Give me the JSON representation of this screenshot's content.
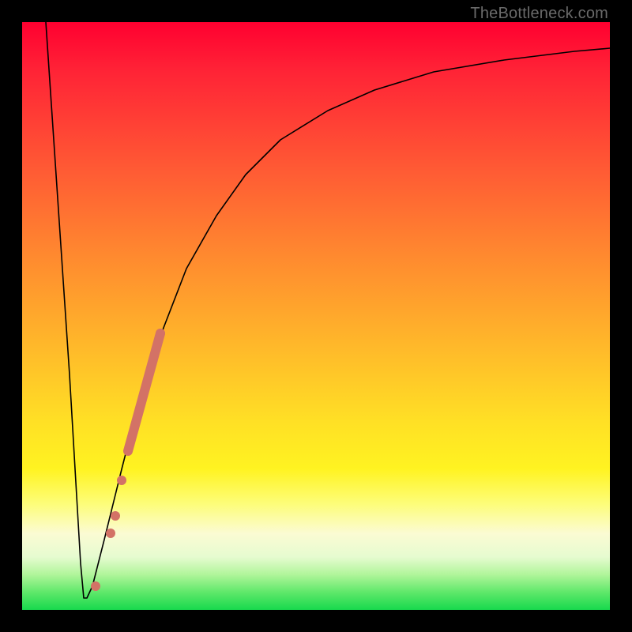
{
  "credit": "TheBottleneck.com",
  "colors": {
    "frame": "#000000",
    "curve": "#000000",
    "marker": "#d37266",
    "gradient_stops": [
      "#ff0030",
      "#ff2236",
      "#ff5a34",
      "#ff8a2f",
      "#ffb82a",
      "#ffe025",
      "#fff321",
      "#fdfd7a",
      "#fbfbd3",
      "#e6fbd0",
      "#b0f59a",
      "#5fe86a",
      "#17d94d"
    ]
  },
  "chart_data": {
    "type": "line",
    "title": "",
    "xlabel": "",
    "ylabel": "",
    "xlim": [
      0,
      100
    ],
    "ylim": [
      0,
      100
    ],
    "note": "No axis tick labels are rendered in the image; values below are read as % of plot width (x) and plot height (y) from bottom-left of the gradient area.",
    "series": [
      {
        "name": "curve",
        "x": [
          4,
          6,
          8,
          10,
          10.5,
          11,
          12,
          14,
          17,
          20,
          24,
          28,
          33,
          38,
          44,
          52,
          60,
          70,
          82,
          94,
          100
        ],
        "y": [
          100,
          70,
          40,
          8,
          2,
          2,
          4,
          12,
          24,
          36,
          48,
          58,
          67,
          74,
          80,
          85,
          88.5,
          91.5,
          93.5,
          95,
          95.5
        ]
      }
    ],
    "markers": {
      "name": "highlight-cluster",
      "shape": "circle",
      "color": "#d37266",
      "points_xy_pct": [
        [
          12.5,
          4
        ],
        [
          15.0,
          13
        ],
        [
          15.8,
          16
        ],
        [
          17.0,
          22
        ],
        [
          23.5,
          47
        ]
      ],
      "bar_segment_xy_pct": {
        "x1": 18.0,
        "y1": 27,
        "x2": 23.5,
        "y2": 47
      }
    }
  }
}
